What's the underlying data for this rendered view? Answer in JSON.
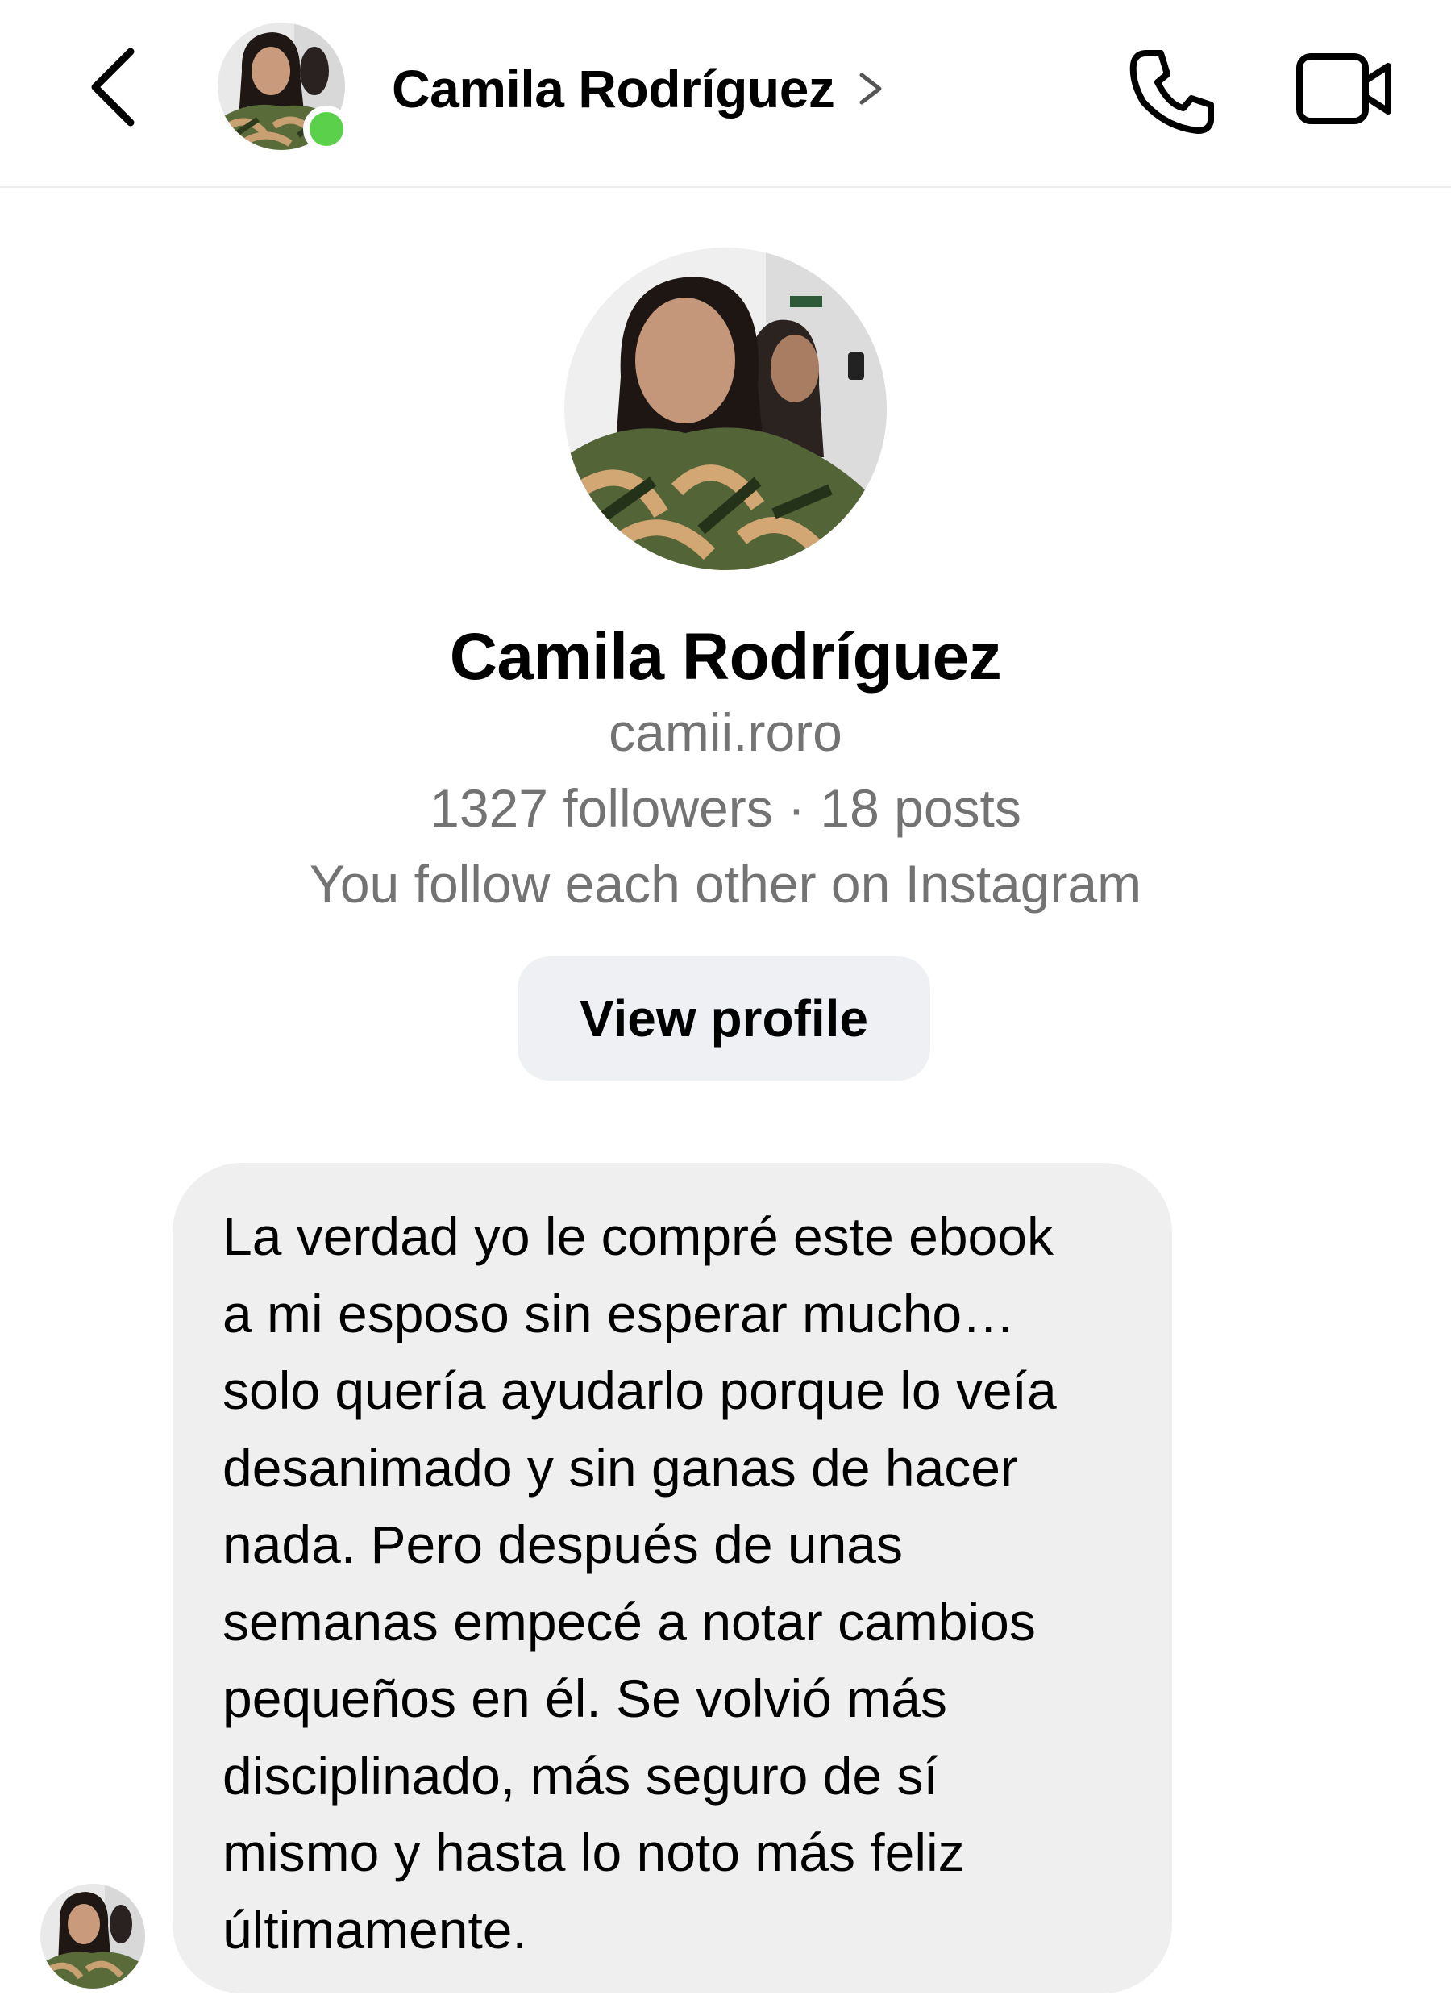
{
  "header": {
    "contact_name": "Camila Rodríguez",
    "online_status": "online",
    "icons": {
      "back": "chevron-left-icon",
      "name_chevron": "chevron-right-icon",
      "call": "phone-icon",
      "video": "video-camera-icon"
    }
  },
  "profile": {
    "name": "Camila Rodríguez",
    "username": "camii.roro",
    "stats": "1327 followers · 18 posts",
    "follow_info": "You follow each other on Instagram",
    "view_profile_label": "View profile"
  },
  "message": {
    "lines": [
      "La verdad yo le compré este ebook",
      "a mi esposo sin esperar mucho…",
      "solo quería ayudarlo porque lo veía",
      "desanimado y sin ganas de hacer",
      "nada. Pero después de unas",
      "semanas empecé a notar cambios",
      "pequeños en él. Se volvió más",
      "disciplinado, más seguro de sí",
      "mismo y hasta lo noto más feliz",
      "últimamente."
    ]
  },
  "colors": {
    "online_dot": "#5bd14b",
    "bubble_bg": "#efefef",
    "button_bg": "#eef0f4",
    "secondary_text": "#737373"
  }
}
